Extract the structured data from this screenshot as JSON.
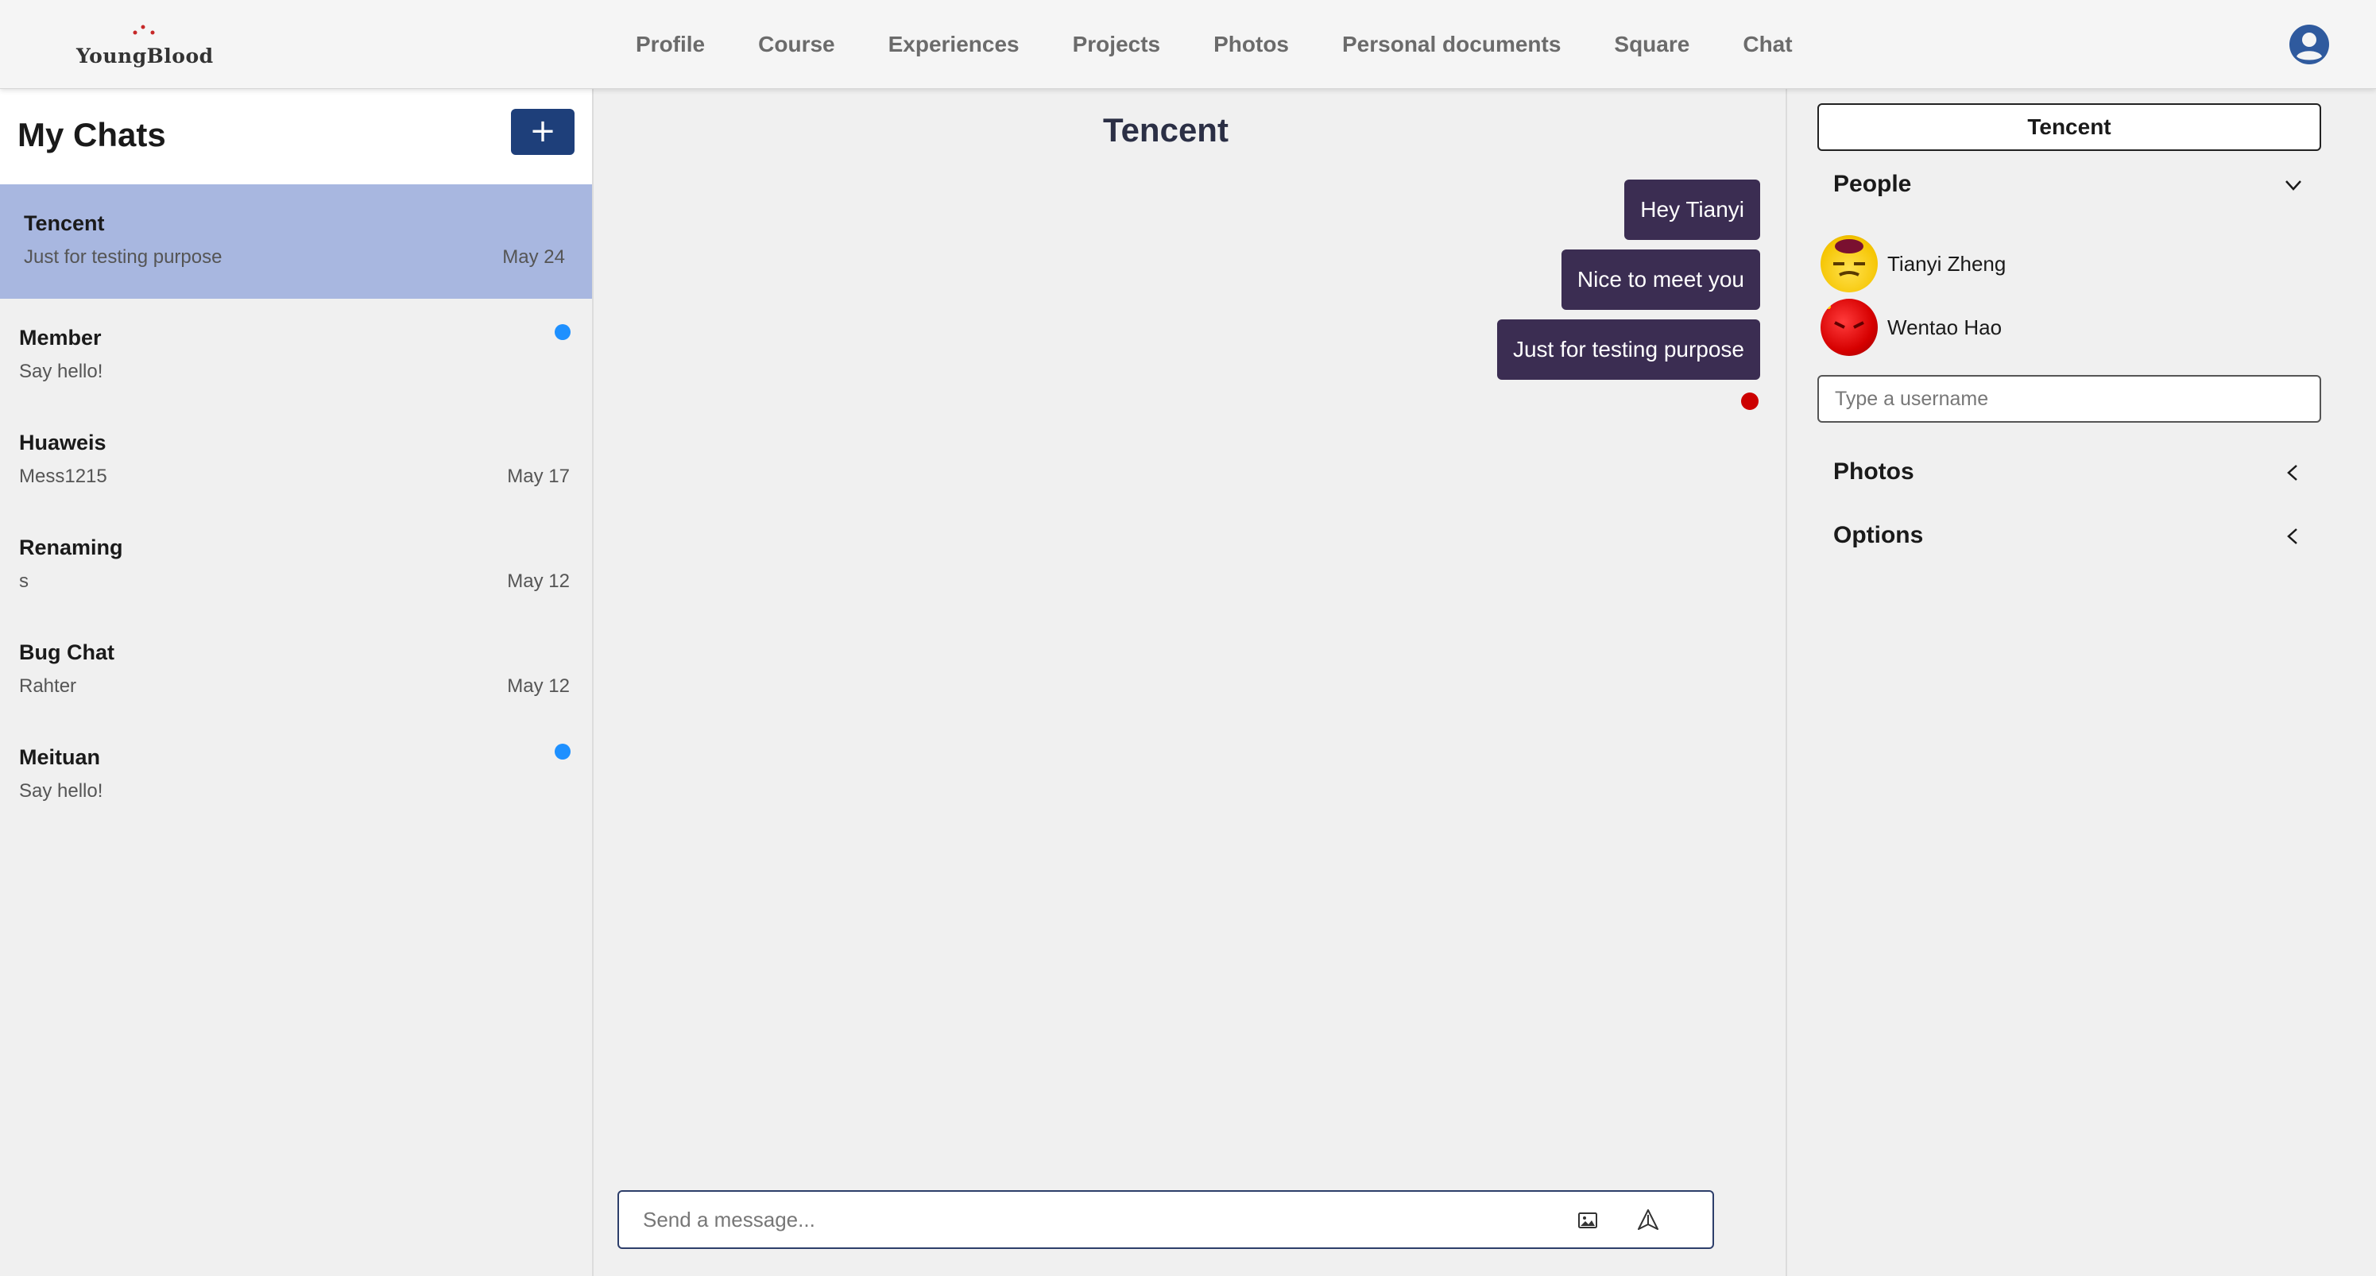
{
  "brand": {
    "name": "YoungBlood"
  },
  "nav": {
    "items": [
      "Profile",
      "Course",
      "Experiences",
      "Projects",
      "Photos",
      "Personal documents",
      "Square",
      "Chat"
    ]
  },
  "header": {
    "account_icon": "user-circle-icon"
  },
  "sidebar": {
    "title": "My Chats",
    "new_chat_label": "+",
    "chats": [
      {
        "name": "Tencent",
        "preview": "Just for testing purpose",
        "date": "May 24",
        "unread": false,
        "active": true
      },
      {
        "name": "Member",
        "preview": "Say hello!",
        "date": "",
        "unread": true,
        "active": false
      },
      {
        "name": "Huaweis",
        "preview": "Mess1215",
        "date": "May 17",
        "unread": false,
        "active": false
      },
      {
        "name": "Renaming",
        "preview": "s",
        "date": "May 12",
        "unread": false,
        "active": false
      },
      {
        "name": "Bug Chat",
        "preview": "Rahter",
        "date": "May 12",
        "unread": false,
        "active": false
      },
      {
        "name": "Meituan",
        "preview": "Say hello!",
        "date": "",
        "unread": true,
        "active": false
      }
    ]
  },
  "conversation": {
    "title": "Tencent",
    "messages": [
      "Hey Tianyi",
      "Nice to meet you",
      "Just for testing purpose"
    ],
    "composer_placeholder": "Send a message...",
    "image_icon": "image-icon",
    "send_icon": "send-icon"
  },
  "details": {
    "chat_name": "Tencent",
    "people_label": "People",
    "members": [
      {
        "name": "Tianyi Zheng"
      },
      {
        "name": "Wentao Hao"
      }
    ],
    "username_placeholder": "Type a username",
    "photos_label": "Photos",
    "options_label": "Options"
  },
  "colors": {
    "accent": "#1e3f7a",
    "active_chat": "#a8b7e0",
    "message_bubble": "#3b2d52",
    "unread_dot": "#1e90ff",
    "read_dot": "#cc0000"
  }
}
